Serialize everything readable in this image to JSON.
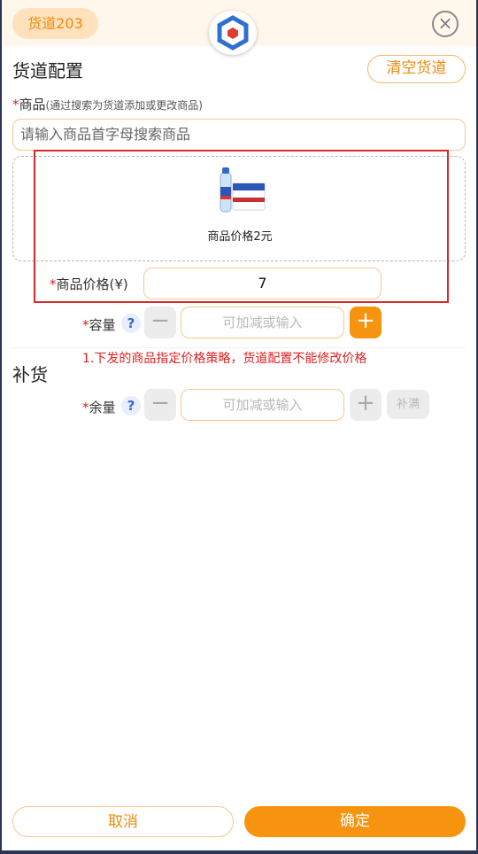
{
  "header": {
    "lane_badge": "货道203",
    "close_symbol": "×"
  },
  "lane_config": {
    "title": "货道配置",
    "clear_button": "清空货道",
    "goods_label": "商品",
    "goods_hint": "(通过搜索为货道添加或更改商品)",
    "search_placeholder": "请输入商品首字母搜索商品",
    "product": {
      "name": "商品价格2元",
      "icon": "water-bottle-and-box-product-image"
    },
    "price_label": "商品价格(¥)",
    "price_value": "7",
    "capacity_label": "容量",
    "capacity_placeholder": "可加减或输入",
    "help_symbol": "?",
    "minus_symbol": "−",
    "plus_symbol": "+",
    "note": "1.下发的商品指定价格策略，货道配置不能修改价格"
  },
  "restock": {
    "title": "补货",
    "remaining_label": "余量",
    "remaining_placeholder": "可加减或输入",
    "fill_button": "补满"
  },
  "footer": {
    "cancel": "取消",
    "confirm": "确定"
  },
  "required_mark": "*",
  "colors": {
    "accent": "#f7940f",
    "required": "#e02020",
    "highlight_border": "#d82a2a",
    "help": "#2e6bd8"
  }
}
